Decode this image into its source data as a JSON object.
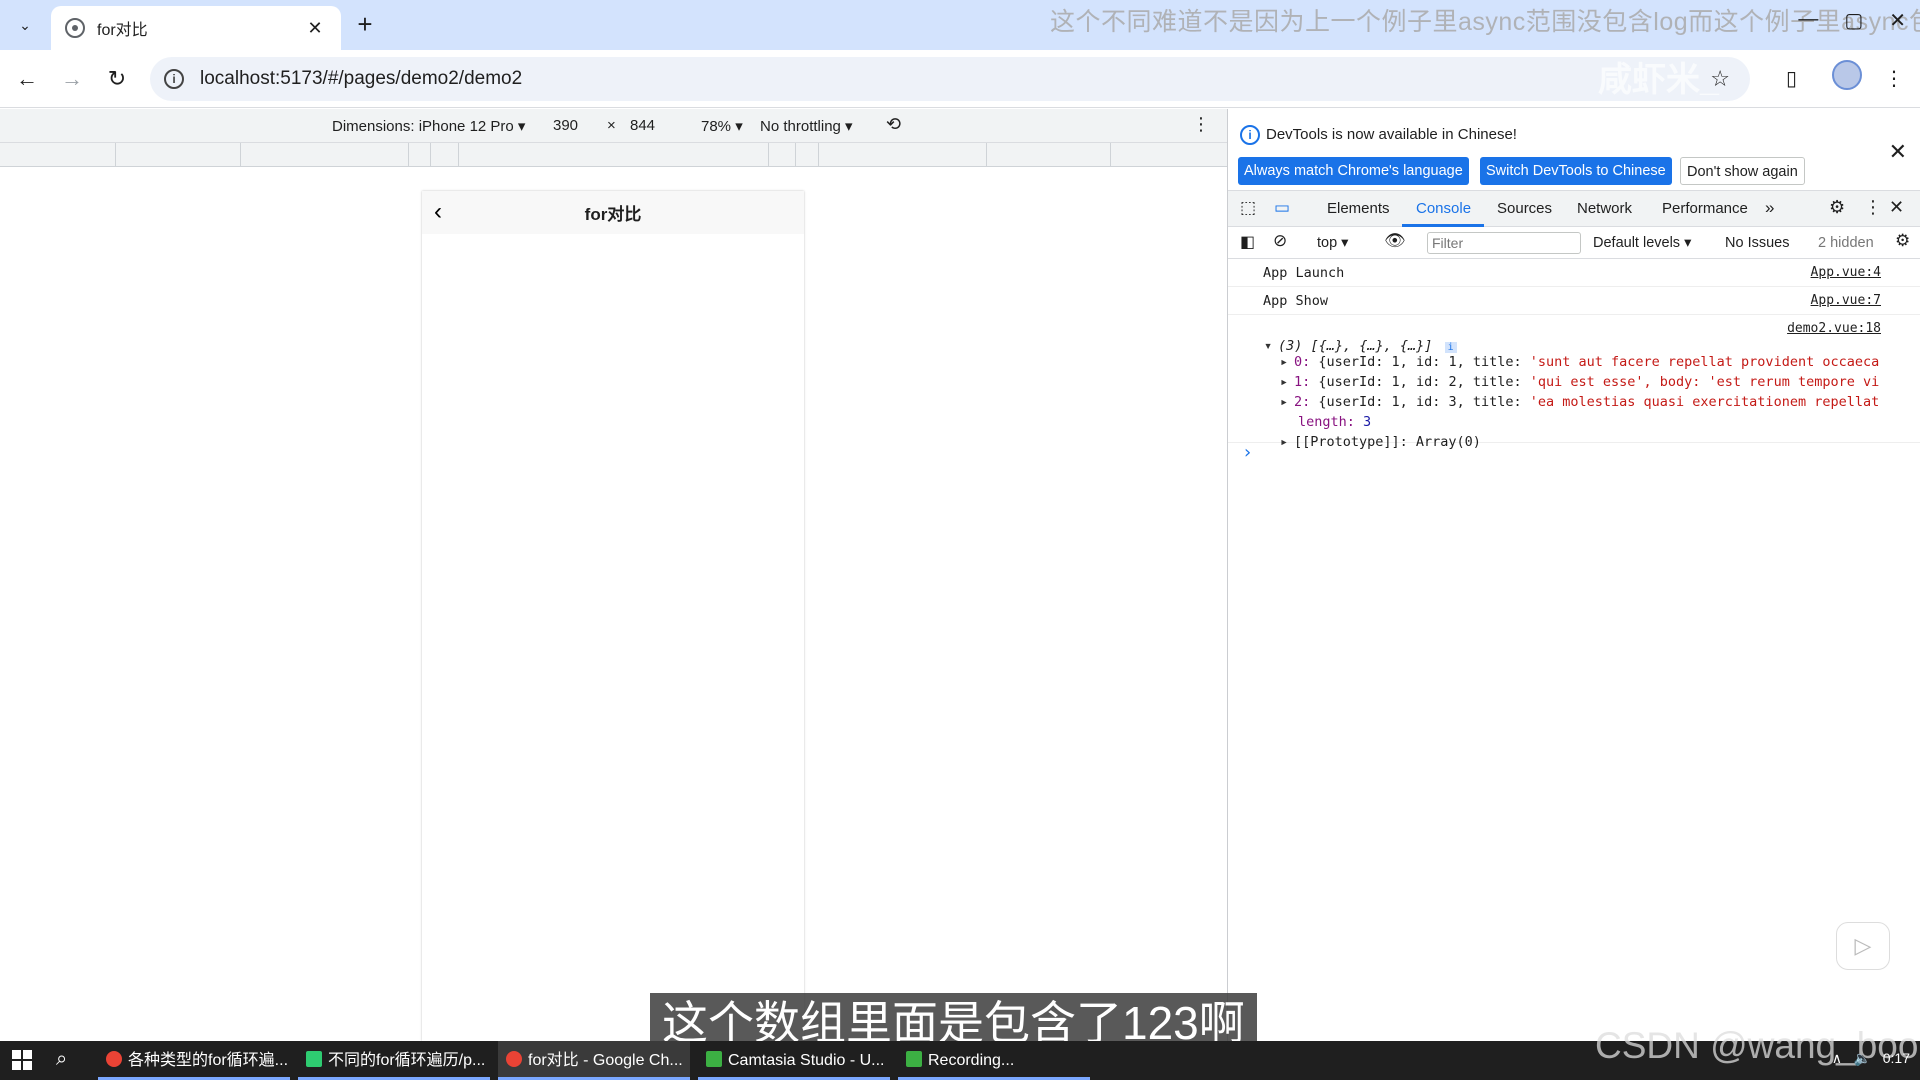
{
  "browser": {
    "tab_title": "for对比",
    "tab_close": "✕",
    "new_tab": "+",
    "overlay_caption": "这个不同难道不是因为上一个例子里async范围没包含log而这个例子里async包含",
    "watermark": "咸虾米_",
    "url": "localhost:5173/#/pages/demo2/demo2"
  },
  "device_toolbar": {
    "dimensions": "Dimensions: iPhone 12 Pro ▾",
    "width": "390",
    "times": "×",
    "height": "844",
    "zoom": "78% ▾",
    "throttling": "No throttling ▾"
  },
  "page": {
    "nav_title": "for对比",
    "back": "‹"
  },
  "subtitle": "这个数组里面是包含了123啊",
  "devtools": {
    "banner_text": "DevTools is now available in Chinese!",
    "btn_match": "Always match Chrome's language",
    "btn_switch": "Switch DevTools to Chinese",
    "btn_dont_show": "Don't show again",
    "tabs": [
      "Elements",
      "Console",
      "Sources",
      "Network",
      "Performance",
      "»"
    ],
    "filter": {
      "context": "top ▾",
      "placeholder": "Filter",
      "levels": "Default levels ▾",
      "issues": "No Issues",
      "hidden": "2 hidden"
    },
    "console": {
      "rows": [
        {
          "msg": "App Launch",
          "src": "App.vue:4"
        },
        {
          "msg": "App Show",
          "src": "App.vue:7"
        }
      ],
      "group_src": "demo2.vue:18",
      "array_summary": "(3) [{…}, {…}, {…}]",
      "items": [
        {
          "index": "0:",
          "body": "{userId: 1, id: 1, title: ",
          "title": "'sunt aut facere repellat provident occaeca"
        },
        {
          "index": "1:",
          "body": "{userId: 1, id: 2, title: ",
          "title": "'qui est esse', body: 'est rerum tempore vi"
        },
        {
          "index": "2:",
          "body": "{userId: 1, id: 3, title: ",
          "title": "'ea molestias quasi exercitationem repellat"
        }
      ],
      "length_key": "length:",
      "length_val": "3",
      "prototype": "[[Prototype]]: Array(0)",
      "prompt": "›"
    }
  },
  "taskbar": {
    "items": [
      {
        "label": "各种类型的for循环遍...",
        "color": "#ea4335"
      },
      {
        "label": "不同的for循环遍历/p...",
        "color": "#2ecc71"
      },
      {
        "label": "for对比 - Google Ch...",
        "color": "#ea4335"
      },
      {
        "label": "Camtasia Studio - U...",
        "color": "#3cb043"
      },
      {
        "label": "Recording...",
        "color": "#3cb043"
      }
    ],
    "watermark": "CSDN @wang_book",
    "clock": "0:17"
  }
}
